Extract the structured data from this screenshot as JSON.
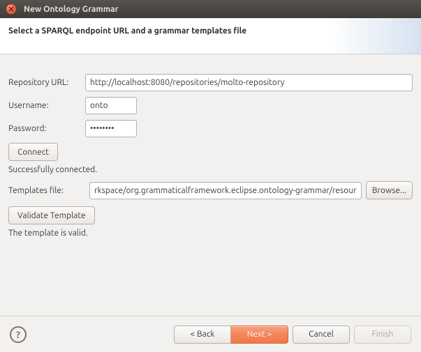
{
  "window": {
    "title": "New Ontology Grammar"
  },
  "header": {
    "title": "Select a SPARQL endpoint URL and a grammar templates file"
  },
  "form": {
    "repository_label": "Repository URL:",
    "repository_value": "http://localhost:8080/repositories/molto-repository",
    "username_label": "Username:",
    "username_value": "onto",
    "password_label": "Password:",
    "password_value": "••••••••",
    "connect_label": "Connect",
    "connect_status": "Successfully connected.",
    "templates_label": "Templates file:",
    "templates_value": "rkspace/org.grammaticalframework.eclipse.ontology-grammar/resources/template.xml",
    "browse_label": "Browse...",
    "validate_label": "Validate Template",
    "validate_status": "The template is valid."
  },
  "footer": {
    "help": "?",
    "back": "< Back",
    "next": "Next >",
    "cancel": "Cancel",
    "finish": "Finish"
  }
}
